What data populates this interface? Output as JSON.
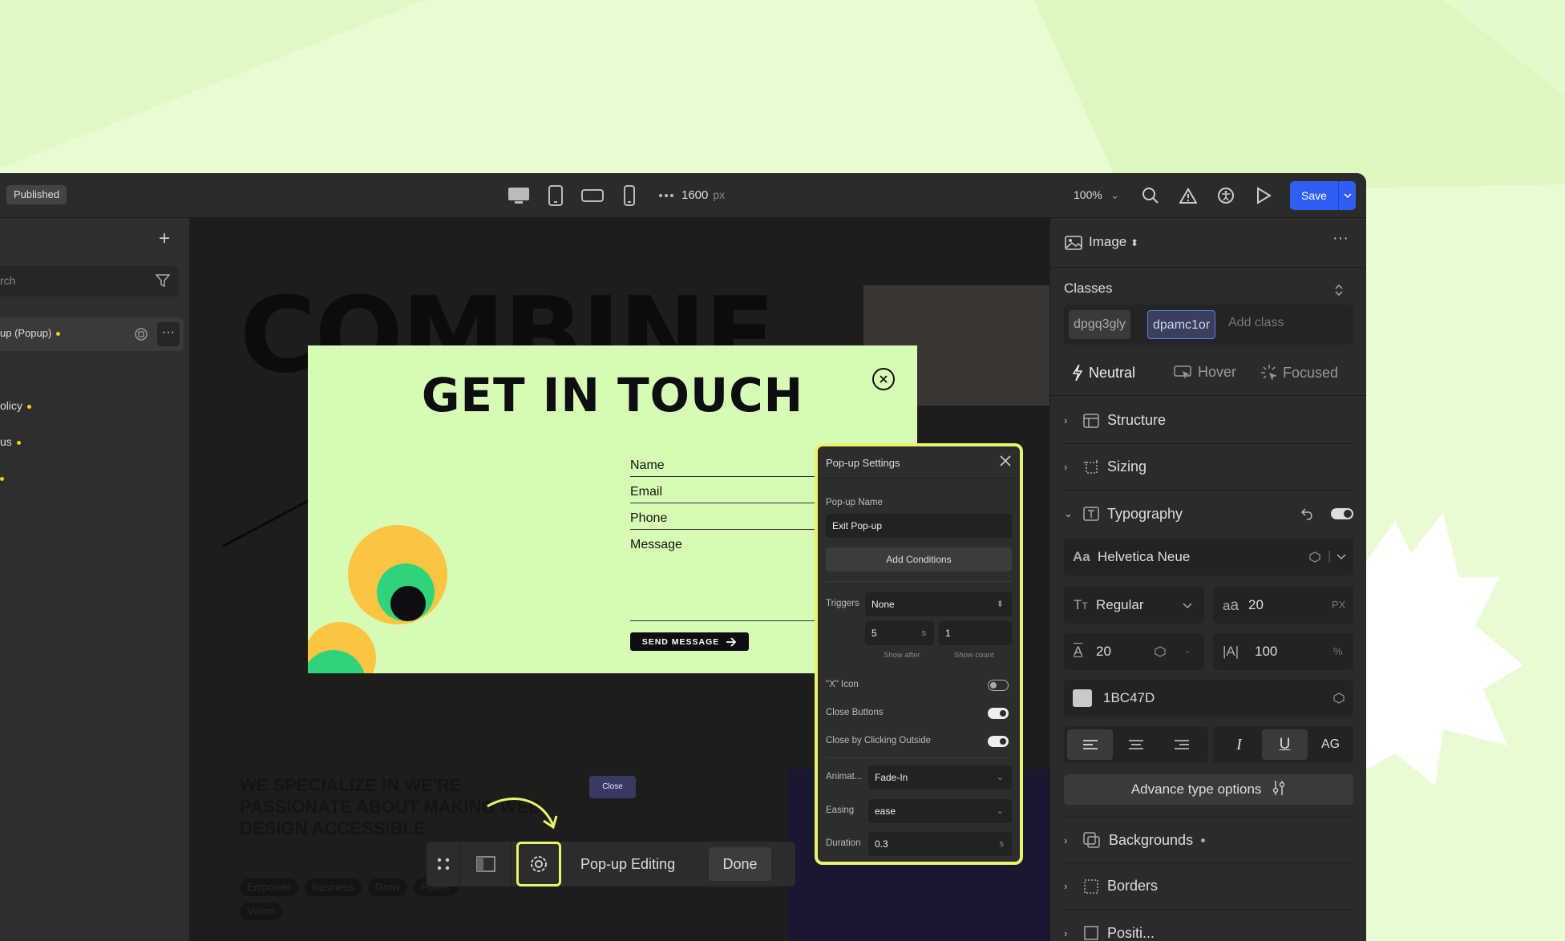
{
  "topbar": {
    "status": "Published",
    "canvas_width": "1600",
    "canvas_width_unit": "px",
    "zoom": "100%",
    "save_label": "Save"
  },
  "navigator": {
    "search_placeholder": "rch",
    "selected_item": "up (Popup)",
    "items": [
      {
        "label": "olicy"
      },
      {
        "label": "us"
      },
      {
        "label": ""
      }
    ]
  },
  "canvas": {
    "headline": "COMBINE",
    "tagline": "WE SPECIALIZE IN WE'RE PASSIONATE ABOUT MAKING WEB DESIGN ACCESSIBLE",
    "tags": [
      "Empower",
      "Business",
      "Grow",
      "Power",
      "Vision"
    ],
    "close_chip": "Close"
  },
  "popup": {
    "title": "GET IN TOUCH",
    "fields": {
      "name": "Name",
      "email": "Email",
      "phone": "Phone",
      "message": "Message"
    },
    "send_label": "SEND MESSAGE"
  },
  "popup_toolbar": {
    "label": "Pop-up Editing",
    "done_label": "Done"
  },
  "popup_settings": {
    "title": "Pop-up Settings",
    "name_label": "Pop-up Name",
    "name_value": "Exit Pop-up",
    "add_conditions": "Add Conditions",
    "triggers_label": "Triggers",
    "triggers_value": "None",
    "show_after_value": "5",
    "show_after_unit": "s",
    "show_after_label": "Show after",
    "show_count_value": "1",
    "show_count_label": "Show count",
    "x_icon_label": "\"X\" Icon",
    "x_icon_on": false,
    "close_buttons_label": "Close Buttons",
    "close_buttons_on": true,
    "close_outside_label": "Close by Clicking Outside",
    "close_outside_on": true,
    "animation_label": "Animat...",
    "animation_value": "Fade-In",
    "easing_label": "Easing",
    "easing_value": "ease",
    "duration_label": "Duration",
    "duration_value": "0.3",
    "duration_unit": "s"
  },
  "style_panel": {
    "element_type": "Image",
    "classes_label": "Classes",
    "classes": [
      "dpgq3gly",
      "dpamc1or"
    ],
    "add_class_placeholder": "Add class",
    "states": [
      "Neutral",
      "Hover",
      "Focused"
    ],
    "sections": {
      "structure": "Structure",
      "sizing": "Sizing",
      "typography": "Typography",
      "backgrounds": "Backgrounds",
      "borders": "Borders",
      "position": "Positi..."
    },
    "font_family": "Helvetica Neue",
    "font_weight": "Regular",
    "font_size": "20",
    "font_size_unit": "PX",
    "line_height": "20",
    "line_height_unit": "-",
    "letter_spacing": "100",
    "letter_spacing_unit": "%",
    "color_hex": "1BC47D",
    "case_label": "AG",
    "advance_label": "Advance type options"
  },
  "colors": {
    "accent_blue": "#2f5ef5",
    "highlight_yellow": "#e8f56a",
    "popup_bg": "#d7fbb4",
    "page_bg": "#e9fbd3"
  }
}
